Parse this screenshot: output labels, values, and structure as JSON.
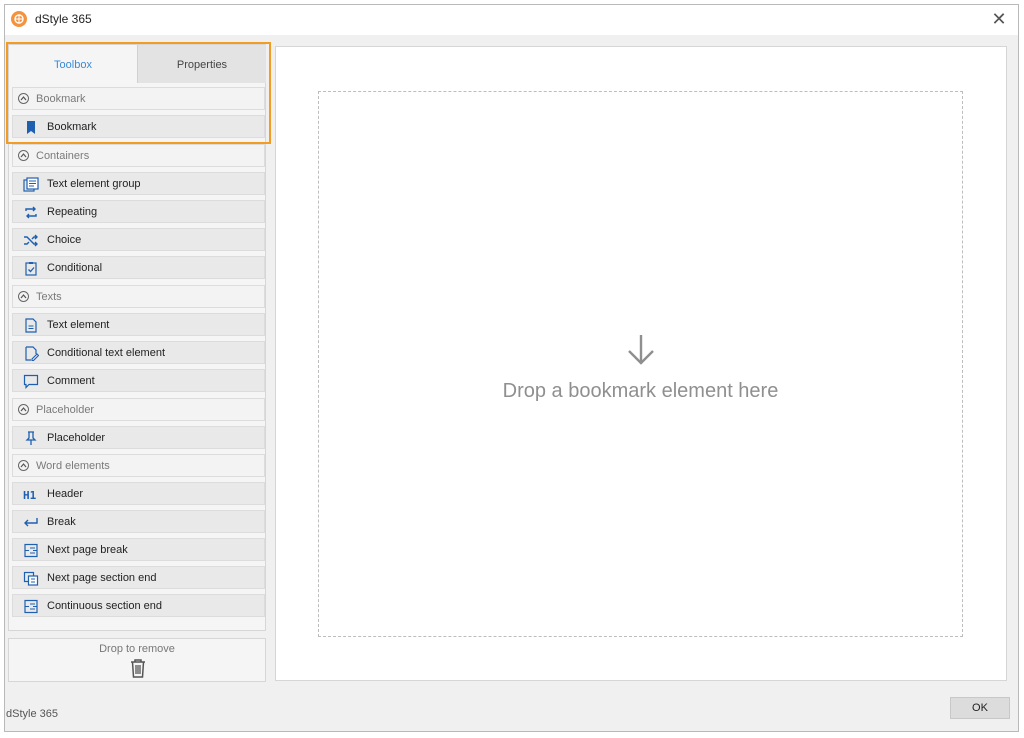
{
  "window": {
    "title": "dStyle 365",
    "footer_title": "dStyle 365"
  },
  "tabs": [
    {
      "label": "Toolbox",
      "active": true
    },
    {
      "label": "Properties",
      "active": false
    }
  ],
  "toolbox": {
    "sections": [
      {
        "label": "Bookmark",
        "items": [
          {
            "label": "Bookmark",
            "icon": "bookmark-icon"
          }
        ]
      },
      {
        "label": "Containers",
        "items": [
          {
            "label": "Text element group",
            "icon": "text-group-icon"
          },
          {
            "label": "Repeating",
            "icon": "repeat-icon"
          },
          {
            "label": "Choice",
            "icon": "shuffle-icon"
          },
          {
            "label": "Conditional",
            "icon": "clipboard-check-icon"
          }
        ]
      },
      {
        "label": "Texts",
        "items": [
          {
            "label": "Text element",
            "icon": "document-icon"
          },
          {
            "label": "Conditional text element",
            "icon": "document-edit-icon"
          },
          {
            "label": "Comment",
            "icon": "comment-icon"
          }
        ]
      },
      {
        "label": "Placeholder",
        "items": [
          {
            "label": "Placeholder",
            "icon": "pin-icon"
          }
        ]
      },
      {
        "label": "Word elements",
        "items": [
          {
            "label": "Header",
            "icon": "h1-icon"
          },
          {
            "label": "Break",
            "icon": "return-arrow-icon"
          },
          {
            "label": "Next page break",
            "icon": "page-break-icon"
          },
          {
            "label": "Next page section end",
            "icon": "section-end-icon"
          },
          {
            "label": "Continuous section end",
            "icon": "continuous-section-icon"
          }
        ]
      }
    ]
  },
  "trash": {
    "label": "Drop to remove",
    "icon": "trash-icon"
  },
  "dropzone": {
    "text": "Drop a bookmark element here",
    "icon": "arrow-down-icon"
  },
  "buttons": {
    "ok": "OK"
  },
  "colors": {
    "accent": "#3a8ad6",
    "highlight": "#f39c24",
    "icon_blue": "#1f5fb0",
    "app_icon": "#f5923e"
  }
}
